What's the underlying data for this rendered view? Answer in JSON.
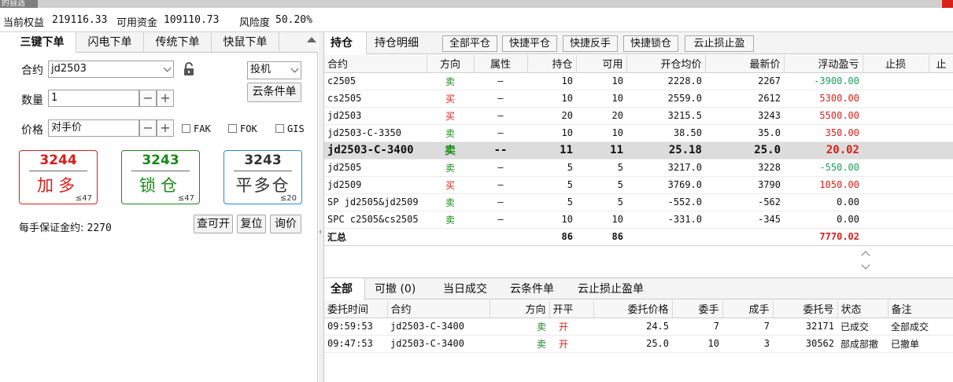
{
  "window_tab": "的自选",
  "infobar": {
    "equity_label": "当前权益",
    "equity": "219116.33",
    "avail_label": "可用资金",
    "avail": "109110.73",
    "risk_label": "风险度",
    "risk": "50.20%"
  },
  "left_tabs": [
    "三键下单",
    "闪电下单",
    "传统下单",
    "快鼠下单"
  ],
  "order_form": {
    "contract_label": "合约",
    "contract": "jd2503",
    "hedge": "投机",
    "cloud_btn": "云条件单",
    "qty_label": "数量",
    "qty": "1",
    "price_label": "价格",
    "price": "对手价",
    "fak": "FAK",
    "fok": "FOK",
    "gis": "GIS",
    "margin_label": "每手保证金约:",
    "margin": "2270",
    "btn_check": "查可开",
    "btn_reset": "复位",
    "btn_quote": "询价"
  },
  "order_buttons": [
    {
      "price": "3244",
      "action": "加多",
      "qty": "≤47",
      "color": "#d8201b"
    },
    {
      "price": "3243",
      "action": "锁仓",
      "qty": "≤47",
      "color": "#1a8a1a"
    },
    {
      "price": "3243",
      "action": "平多仓",
      "qty": "≤20",
      "color": "#333333"
    }
  ],
  "right_tabs": [
    "持仓",
    "持仓明细"
  ],
  "quick_buttons": [
    "全部平仓",
    "快捷平仓",
    "快捷反手",
    "快捷锁仓",
    "云止损止盈"
  ],
  "positions": {
    "headers": [
      "合约",
      "方向",
      "属性",
      "持仓",
      "可用",
      "开仓均价",
      "最新价",
      "浮动盈亏",
      "止损",
      "止"
    ],
    "rows": [
      [
        "c2505",
        "卖",
        "—",
        "10",
        "10",
        "2228.0",
        "2267",
        "-3900.00"
      ],
      [
        "cs2505",
        "买",
        "—",
        "10",
        "10",
        "2559.0",
        "2612",
        "5300.00"
      ],
      [
        "jd2503",
        "买",
        "—",
        "20",
        "20",
        "3215.5",
        "3243",
        "5500.00"
      ],
      [
        "jd2503-C-3350",
        "卖",
        "—",
        "10",
        "10",
        "38.50",
        "35.0",
        "350.00"
      ],
      [
        "jd2503-C-3400",
        "卖",
        "--",
        "11",
        "11",
        "25.18",
        "25.0",
        "20.02"
      ],
      [
        "jd2505",
        "卖",
        "—",
        "5",
        "5",
        "3217.0",
        "3228",
        "-550.00"
      ],
      [
        "jd2509",
        "买",
        "—",
        "5",
        "5",
        "3769.0",
        "3790",
        "1050.00"
      ],
      [
        "SP jd2505&jd2509",
        "卖",
        "—",
        "5",
        "5",
        "-552.0",
        "-562",
        "0.00"
      ],
      [
        "SPC c2505&cs2505",
        "卖",
        "—",
        "10",
        "10",
        "-331.0",
        "-345",
        "0.00"
      ]
    ],
    "total": [
      "汇总",
      "86",
      "86",
      "7770.02"
    ]
  },
  "bottom_tabs": [
    "全部",
    "可撤 (0)",
    "当日成交",
    "云条件单",
    "云止损止盈单"
  ],
  "orders": {
    "headers": [
      "委托时间",
      "合约",
      "方向",
      "开平",
      "委托价格",
      "委手",
      "成手",
      "委托号",
      "状态",
      "备注"
    ],
    "rows": [
      [
        "09:59:53",
        "jd2503-C-3400",
        "卖",
        "开",
        "24.5",
        "7",
        "7",
        "32171",
        "已成交",
        "全部成交"
      ],
      [
        "09:47:53",
        "jd2503-C-3400",
        "卖",
        "开",
        "25.0",
        "10",
        "3",
        "30562",
        "部成部撤",
        "已撤单"
      ]
    ]
  },
  "colors": {
    "buy": "#d8201b",
    "sell": "#1a8a1a",
    "loss": "#1aa05a",
    "profit": "#d8201b"
  }
}
